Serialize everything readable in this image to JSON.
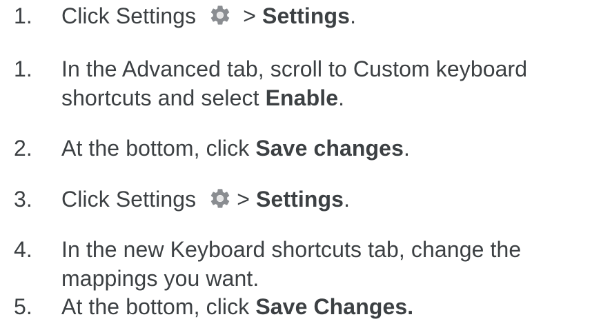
{
  "steps": [
    {
      "number": "1.",
      "before": "Click Settings ",
      "icon": "gear-icon",
      "after": " > ",
      "bold": "Settings",
      "end": "."
    },
    {
      "number": "1.",
      "line1": "In the Advanced tab, scroll to Custom keyboard",
      "line2_before": "shortcuts and select ",
      "bold": "Enable",
      "end": "."
    },
    {
      "number": "2.",
      "before": "At the bottom, click ",
      "bold": "Save changes",
      "end": "."
    },
    {
      "number": "3.",
      "before": "Click Settings ",
      "icon": "gear-icon",
      "after": "> ",
      "bold": "Settings",
      "end": "."
    },
    {
      "number": "4.",
      "line1": "In the new Keyboard shortcuts tab, change the",
      "line2": "mappings you want."
    },
    {
      "number": "5.",
      "before": "At the bottom, click ",
      "bold": "Save Changes."
    }
  ],
  "colors": {
    "text": "#3c4043",
    "gear": "#8a8d91"
  }
}
